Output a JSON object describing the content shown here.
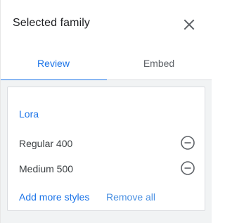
{
  "panel": {
    "title": "Selected family"
  },
  "tabs": [
    {
      "label": "Review",
      "active": true
    },
    {
      "label": "Embed",
      "active": false
    }
  ],
  "family": {
    "name": "Lora",
    "styles": [
      {
        "label": "Regular 400"
      },
      {
        "label": "Medium 500"
      }
    ]
  },
  "actions": {
    "add_more": "Add more styles",
    "remove_all": "Remove all"
  },
  "colors": {
    "accent": "#1a73e8",
    "icon": "#5f6368",
    "text": "#202124",
    "content_bg": "#f1f3f4"
  },
  "icons": {
    "close": "close-icon",
    "remove_style": "remove-circle-icon"
  }
}
